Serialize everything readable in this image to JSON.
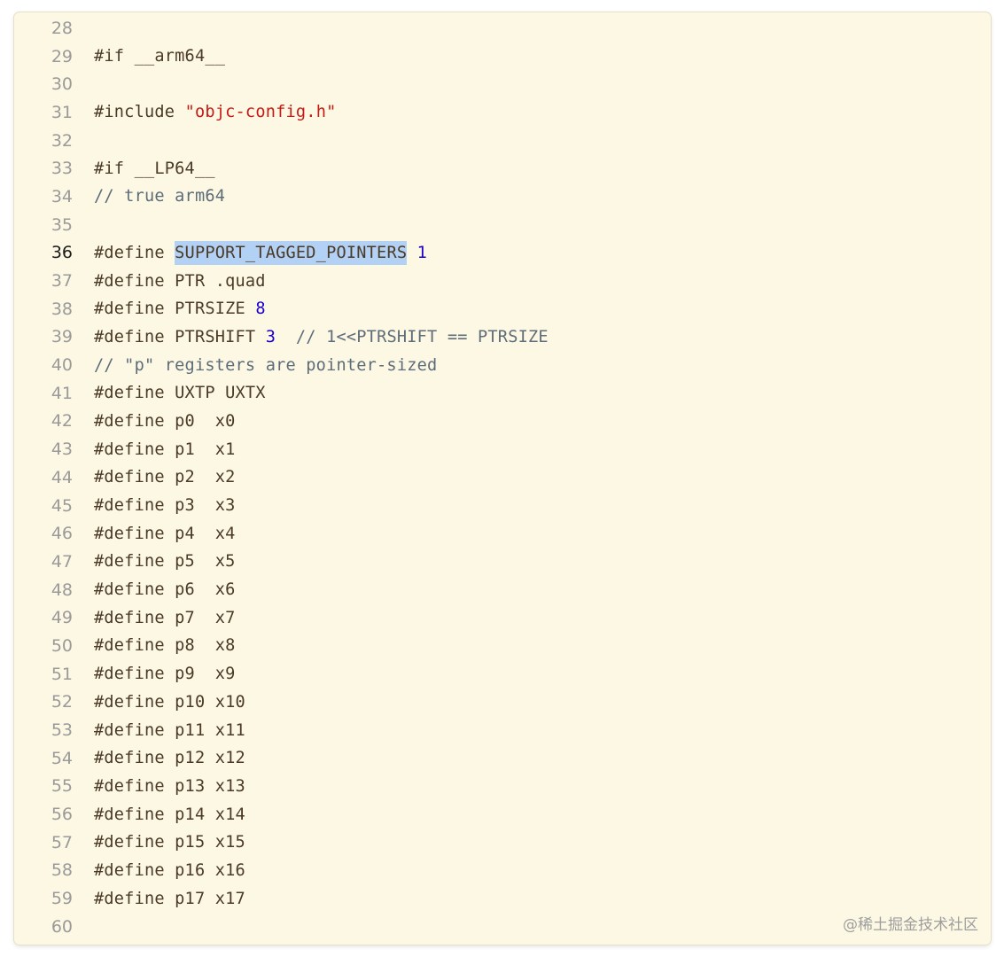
{
  "editor": {
    "active_line": 36,
    "colors": {
      "background": "#fdf8e3",
      "text": "#4a3a26",
      "string": "#c41a16",
      "number": "#1c00cf",
      "comment": "#5d6c79",
      "selection": "#b3d1f5",
      "line_number": "#9a9a9a"
    },
    "lines": [
      {
        "n": "28",
        "tokens": []
      },
      {
        "n": "29",
        "tokens": [
          {
            "t": "#if __arm64__",
            "k": "plain"
          }
        ]
      },
      {
        "n": "30",
        "tokens": []
      },
      {
        "n": "31",
        "tokens": [
          {
            "t": "#include ",
            "k": "plain"
          },
          {
            "t": "\"objc-config.h\"",
            "k": "str"
          }
        ]
      },
      {
        "n": "32",
        "tokens": []
      },
      {
        "n": "33",
        "tokens": [
          {
            "t": "#if __LP64__",
            "k": "plain"
          }
        ]
      },
      {
        "n": "34",
        "tokens": [
          {
            "t": "// true arm64",
            "k": "comment"
          }
        ]
      },
      {
        "n": "35",
        "tokens": []
      },
      {
        "n": "36",
        "tokens": [
          {
            "t": "#define ",
            "k": "plain"
          },
          {
            "t": "SUPPORT_TAGGED_POINTERS",
            "k": "sel"
          },
          {
            "t": " ",
            "k": "plain"
          },
          {
            "t": "1",
            "k": "num"
          }
        ]
      },
      {
        "n": "37",
        "tokens": [
          {
            "t": "#define PTR .quad",
            "k": "plain"
          }
        ]
      },
      {
        "n": "38",
        "tokens": [
          {
            "t": "#define PTRSIZE ",
            "k": "plain"
          },
          {
            "t": "8",
            "k": "num"
          }
        ]
      },
      {
        "n": "39",
        "tokens": [
          {
            "t": "#define PTRSHIFT ",
            "k": "plain"
          },
          {
            "t": "3",
            "k": "num"
          },
          {
            "t": "  // 1<<PTRSHIFT == PTRSIZE",
            "k": "comment"
          }
        ]
      },
      {
        "n": "40",
        "tokens": [
          {
            "t": "// \"p\" registers are pointer-sized",
            "k": "comment"
          }
        ]
      },
      {
        "n": "41",
        "tokens": [
          {
            "t": "#define UXTP UXTX",
            "k": "plain"
          }
        ]
      },
      {
        "n": "42",
        "tokens": [
          {
            "t": "#define p0  x0",
            "k": "plain"
          }
        ]
      },
      {
        "n": "43",
        "tokens": [
          {
            "t": "#define p1  x1",
            "k": "plain"
          }
        ]
      },
      {
        "n": "44",
        "tokens": [
          {
            "t": "#define p2  x2",
            "k": "plain"
          }
        ]
      },
      {
        "n": "45",
        "tokens": [
          {
            "t": "#define p3  x3",
            "k": "plain"
          }
        ]
      },
      {
        "n": "46",
        "tokens": [
          {
            "t": "#define p4  x4",
            "k": "plain"
          }
        ]
      },
      {
        "n": "47",
        "tokens": [
          {
            "t": "#define p5  x5",
            "k": "plain"
          }
        ]
      },
      {
        "n": "48",
        "tokens": [
          {
            "t": "#define p6  x6",
            "k": "plain"
          }
        ]
      },
      {
        "n": "49",
        "tokens": [
          {
            "t": "#define p7  x7",
            "k": "plain"
          }
        ]
      },
      {
        "n": "50",
        "tokens": [
          {
            "t": "#define p8  x8",
            "k": "plain"
          }
        ]
      },
      {
        "n": "51",
        "tokens": [
          {
            "t": "#define p9  x9",
            "k": "plain"
          }
        ]
      },
      {
        "n": "52",
        "tokens": [
          {
            "t": "#define p10 x10",
            "k": "plain"
          }
        ]
      },
      {
        "n": "53",
        "tokens": [
          {
            "t": "#define p11 x11",
            "k": "plain"
          }
        ]
      },
      {
        "n": "54",
        "tokens": [
          {
            "t": "#define p12 x12",
            "k": "plain"
          }
        ]
      },
      {
        "n": "55",
        "tokens": [
          {
            "t": "#define p13 x13",
            "k": "plain"
          }
        ]
      },
      {
        "n": "56",
        "tokens": [
          {
            "t": "#define p14 x14",
            "k": "plain"
          }
        ]
      },
      {
        "n": "57",
        "tokens": [
          {
            "t": "#define p15 x15",
            "k": "plain"
          }
        ]
      },
      {
        "n": "58",
        "tokens": [
          {
            "t": "#define p16 x16",
            "k": "plain"
          }
        ]
      },
      {
        "n": "59",
        "tokens": [
          {
            "t": "#define p17 x17",
            "k": "plain"
          }
        ]
      },
      {
        "n": "60",
        "tokens": []
      }
    ]
  },
  "watermark": "@稀土掘金技术社区"
}
